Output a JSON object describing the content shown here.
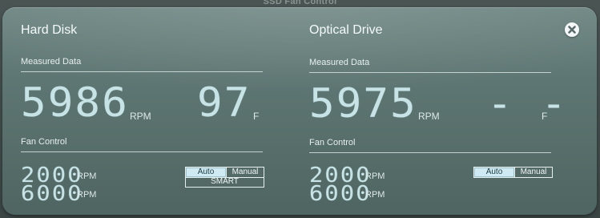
{
  "window": {
    "title": "SSD Fan Control"
  },
  "hard_disk": {
    "title": "Hard Disk",
    "measured_label": "Measured Data",
    "rpm_value": "5986",
    "rpm_unit": "RPM",
    "temp_value": "97",
    "temp_unit": "F",
    "fan_control_label": "Fan Control",
    "min_rpm": "2000",
    "max_rpm": "6000",
    "min_unit": "RPM",
    "max_unit": "RPM",
    "mode_auto": "Auto",
    "mode_manual": "Manual",
    "mode_smart": "SMART",
    "selected_mode": "Auto"
  },
  "optical_drive": {
    "title": "Optical Drive",
    "measured_label": "Measured Data",
    "rpm_value": "5975",
    "rpm_unit": "RPM",
    "temp_value": "- -",
    "temp_unit": "F",
    "fan_control_label": "Fan Control",
    "min_rpm": "2000",
    "max_rpm": "6000",
    "min_unit": "RPM",
    "max_unit": "RPM",
    "mode_auto": "Auto",
    "mode_manual": "Manual",
    "selected_mode": "Auto"
  },
  "icons": {
    "close": "close-circle-icon"
  },
  "colors": {
    "panel": "#5e7673",
    "digits": "#c7e3e6",
    "active_button": "#cfeaf2"
  }
}
